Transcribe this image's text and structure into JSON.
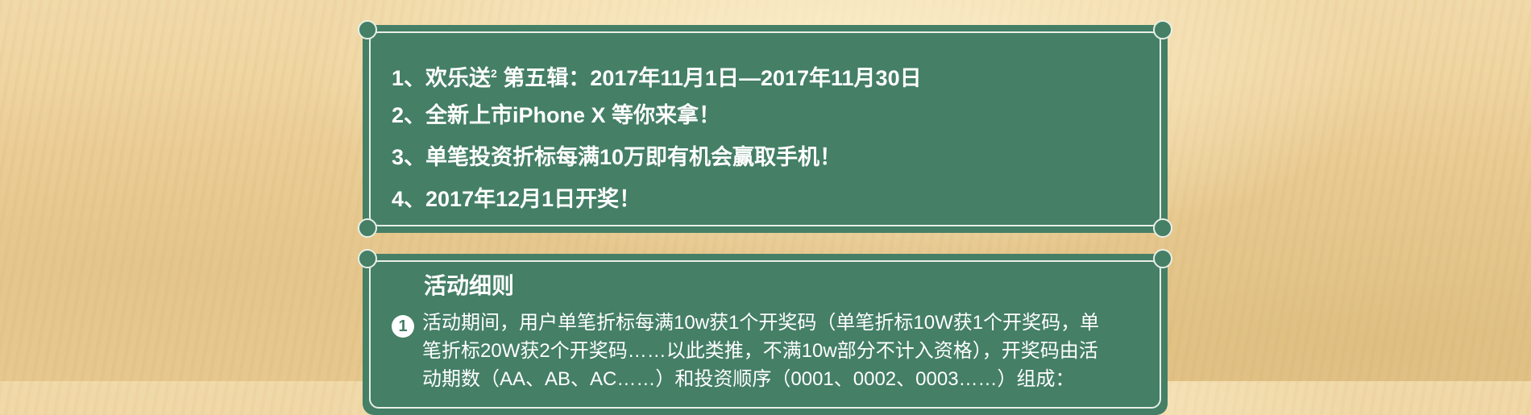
{
  "info_panel": {
    "items": [
      {
        "prefix": "1、欢乐送",
        "sup": "2",
        "suffix": " 第五辑：2017年11月1日—2017年11月30日"
      },
      {
        "prefix": "2、全新上市iPhone X 等你来拿！",
        "sup": "",
        "suffix": ""
      },
      {
        "prefix": "3、单笔投资折标每满10万即有机会赢取手机！",
        "sup": "",
        "suffix": ""
      },
      {
        "prefix": "4、2017年12月1日开奖！",
        "sup": "",
        "suffix": ""
      }
    ]
  },
  "details_panel": {
    "title": "活动细则",
    "rules": [
      {
        "number": "1",
        "text": "活动期间，用户单笔折标每满10w获1个开奖码（单笔折标10W获1个开奖码，单笔折标20W获2个开奖码……以此类推，不满10w部分不计入资格），开奖码由活动期数（AA、AB、AC……）和投资顺序（0001、0002、0003……）组成："
      }
    ]
  },
  "colors": {
    "panel": "#447f66",
    "border": "#e9efe6",
    "text": "#ffffff"
  }
}
